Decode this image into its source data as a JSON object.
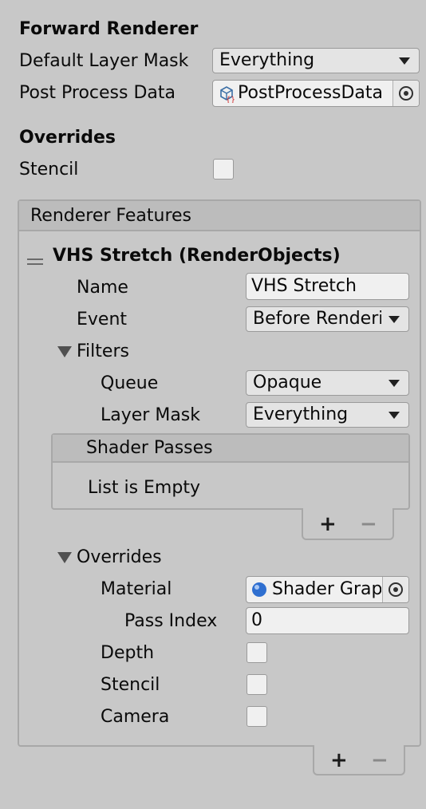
{
  "forward_renderer": {
    "title": "Forward Renderer",
    "default_layer_mask": {
      "label": "Default Layer Mask",
      "value": "Everything"
    },
    "post_process_data": {
      "label": "Post Process Data",
      "value": "PostProcessData"
    }
  },
  "overrides_section": {
    "title": "Overrides",
    "stencil_label": "Stencil",
    "stencil_checked": false
  },
  "renderer_features": {
    "header": "Renderer Features",
    "feature": {
      "title": "VHS Stretch (RenderObjects)",
      "name": {
        "label": "Name",
        "value": "VHS Stretch"
      },
      "event": {
        "label": "Event",
        "value": "Before Renderi"
      },
      "filters": {
        "label": "Filters",
        "queue": {
          "label": "Queue",
          "value": "Opaque"
        },
        "layer_mask": {
          "label": "Layer Mask",
          "value": "Everything"
        },
        "shader_passes": {
          "header": "Shader Passes",
          "empty_text": "List is Empty",
          "add": "+",
          "remove": "−"
        }
      },
      "overrides": {
        "label": "Overrides",
        "material": {
          "label": "Material",
          "value": "Shader Grap"
        },
        "pass_index": {
          "label": "Pass Index",
          "value": "0"
        },
        "depth_label": "Depth",
        "stencil_label": "Stencil",
        "camera_label": "Camera"
      }
    },
    "add": "+",
    "remove": "−"
  },
  "colors": {
    "background": "#c8c8c8",
    "header_bar": "#bcbcbc",
    "field": "#f0f0f0",
    "dropdown": "#e4e4e4",
    "material_dot": "#2f6fd0"
  }
}
